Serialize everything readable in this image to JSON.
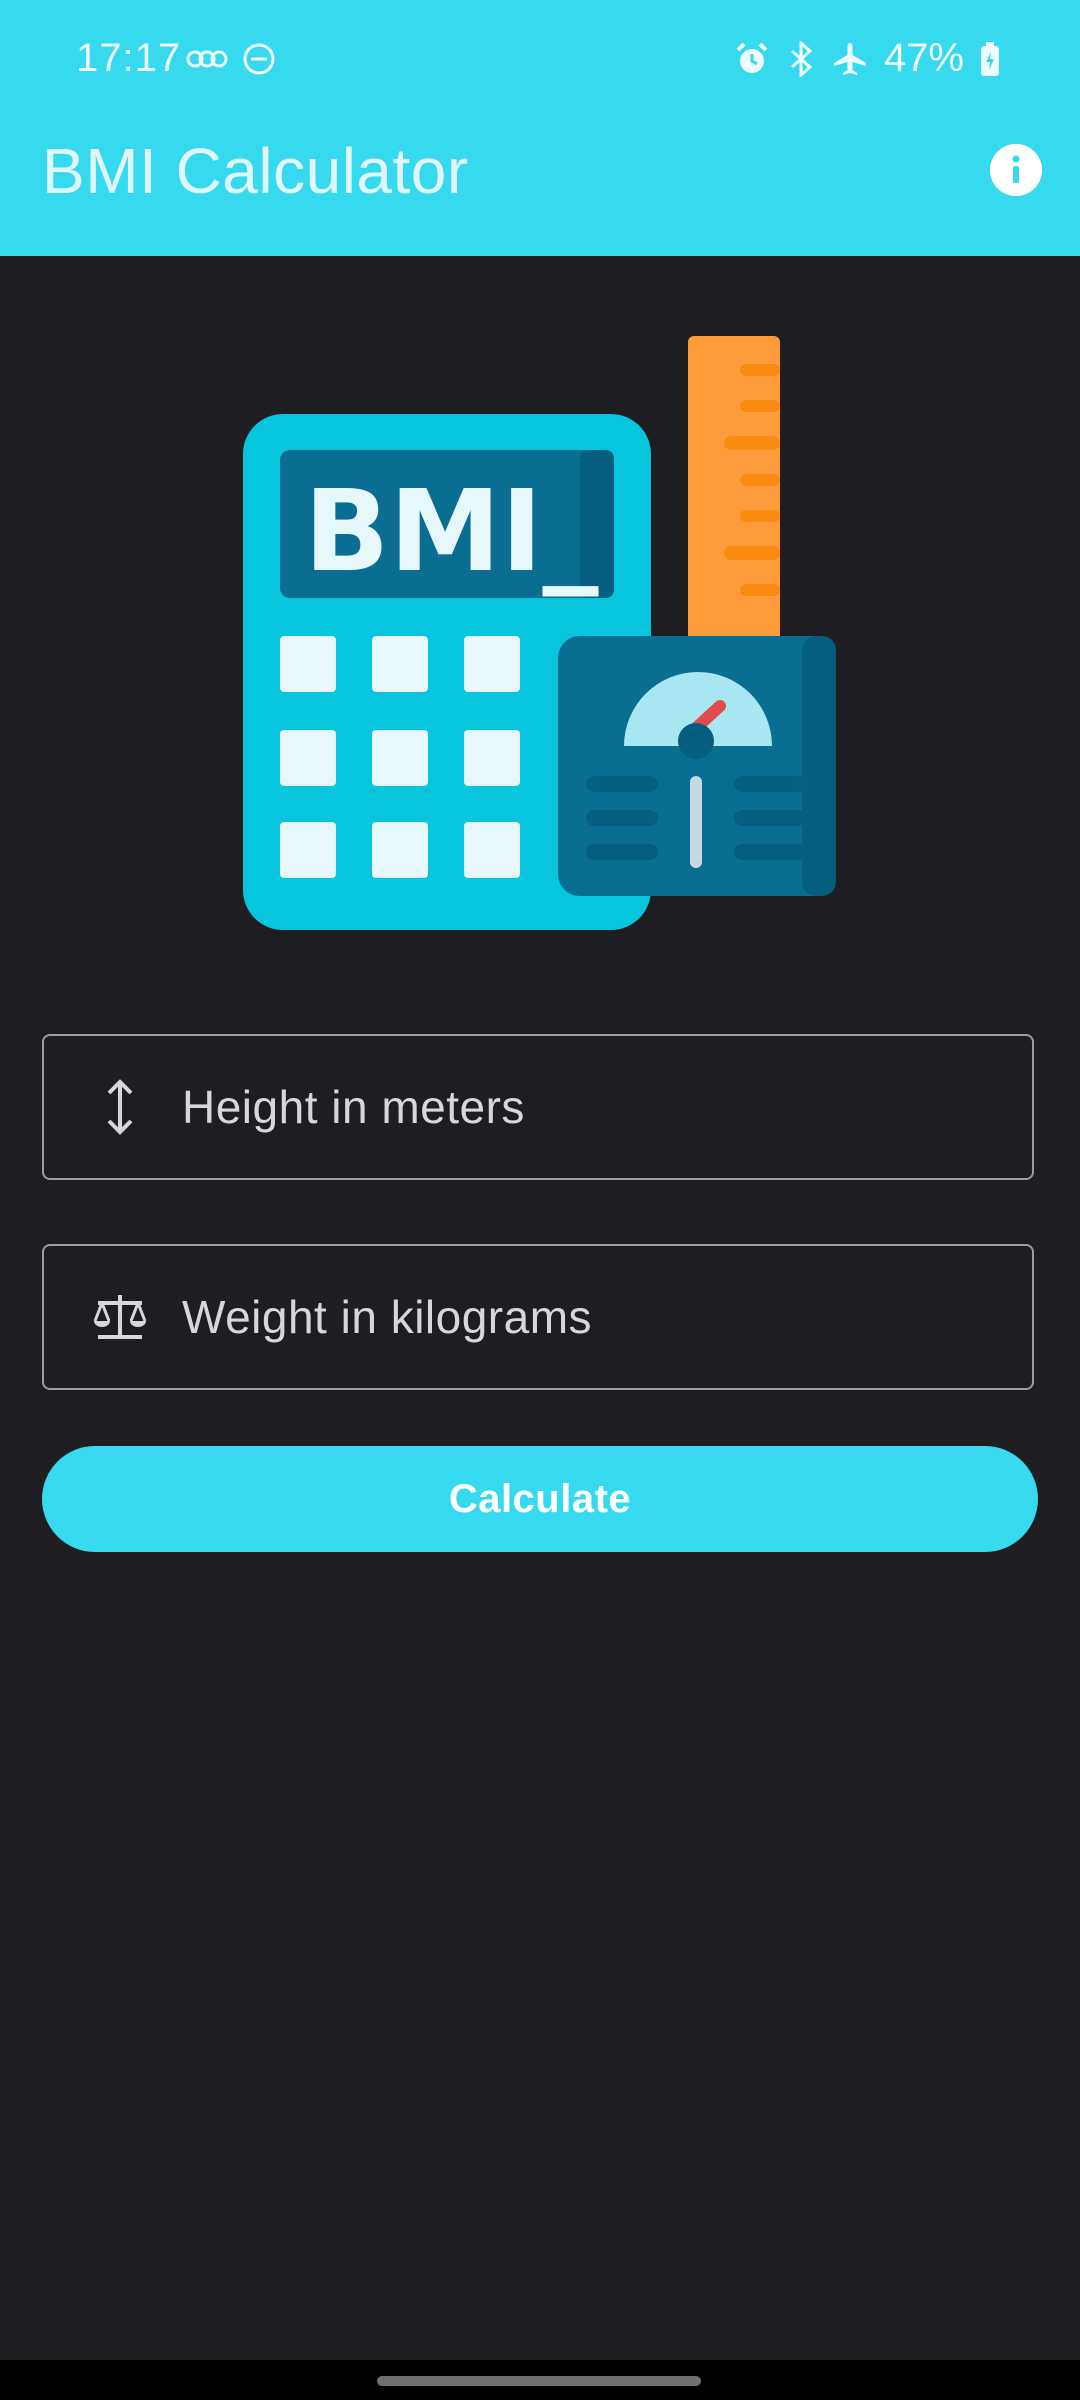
{
  "status_bar": {
    "time": "17:17",
    "battery": "47%",
    "left_icons": [
      "voicemail-icon",
      "do-not-disturb-icon"
    ],
    "right_icons": [
      "alarm-icon",
      "bluetooth-icon",
      "airplane-mode-icon",
      "battery-charging-icon"
    ]
  },
  "app_bar": {
    "title": "BMI Calculator",
    "action_icon": "info-icon"
  },
  "hero": {
    "calculator_display": "BMI_",
    "icons": [
      "calculator-icon",
      "ruler-icon",
      "weighing-scale-icon"
    ]
  },
  "form": {
    "height_field": {
      "placeholder": "Height in meters",
      "icon": "vertical-arrows-icon"
    },
    "weight_field": {
      "placeholder": "Weight in kilograms",
      "icon": "balance-scale-icon"
    },
    "calculate_label": "Calculate"
  },
  "colors": {
    "accent": "#37d9ee",
    "background": "#1e1d22",
    "field_border": "#9d9aa3",
    "ruler_orange": "#fd9a3a",
    "calculator_teal": "#06c5dd",
    "scale_blue": "#0a6e92"
  }
}
